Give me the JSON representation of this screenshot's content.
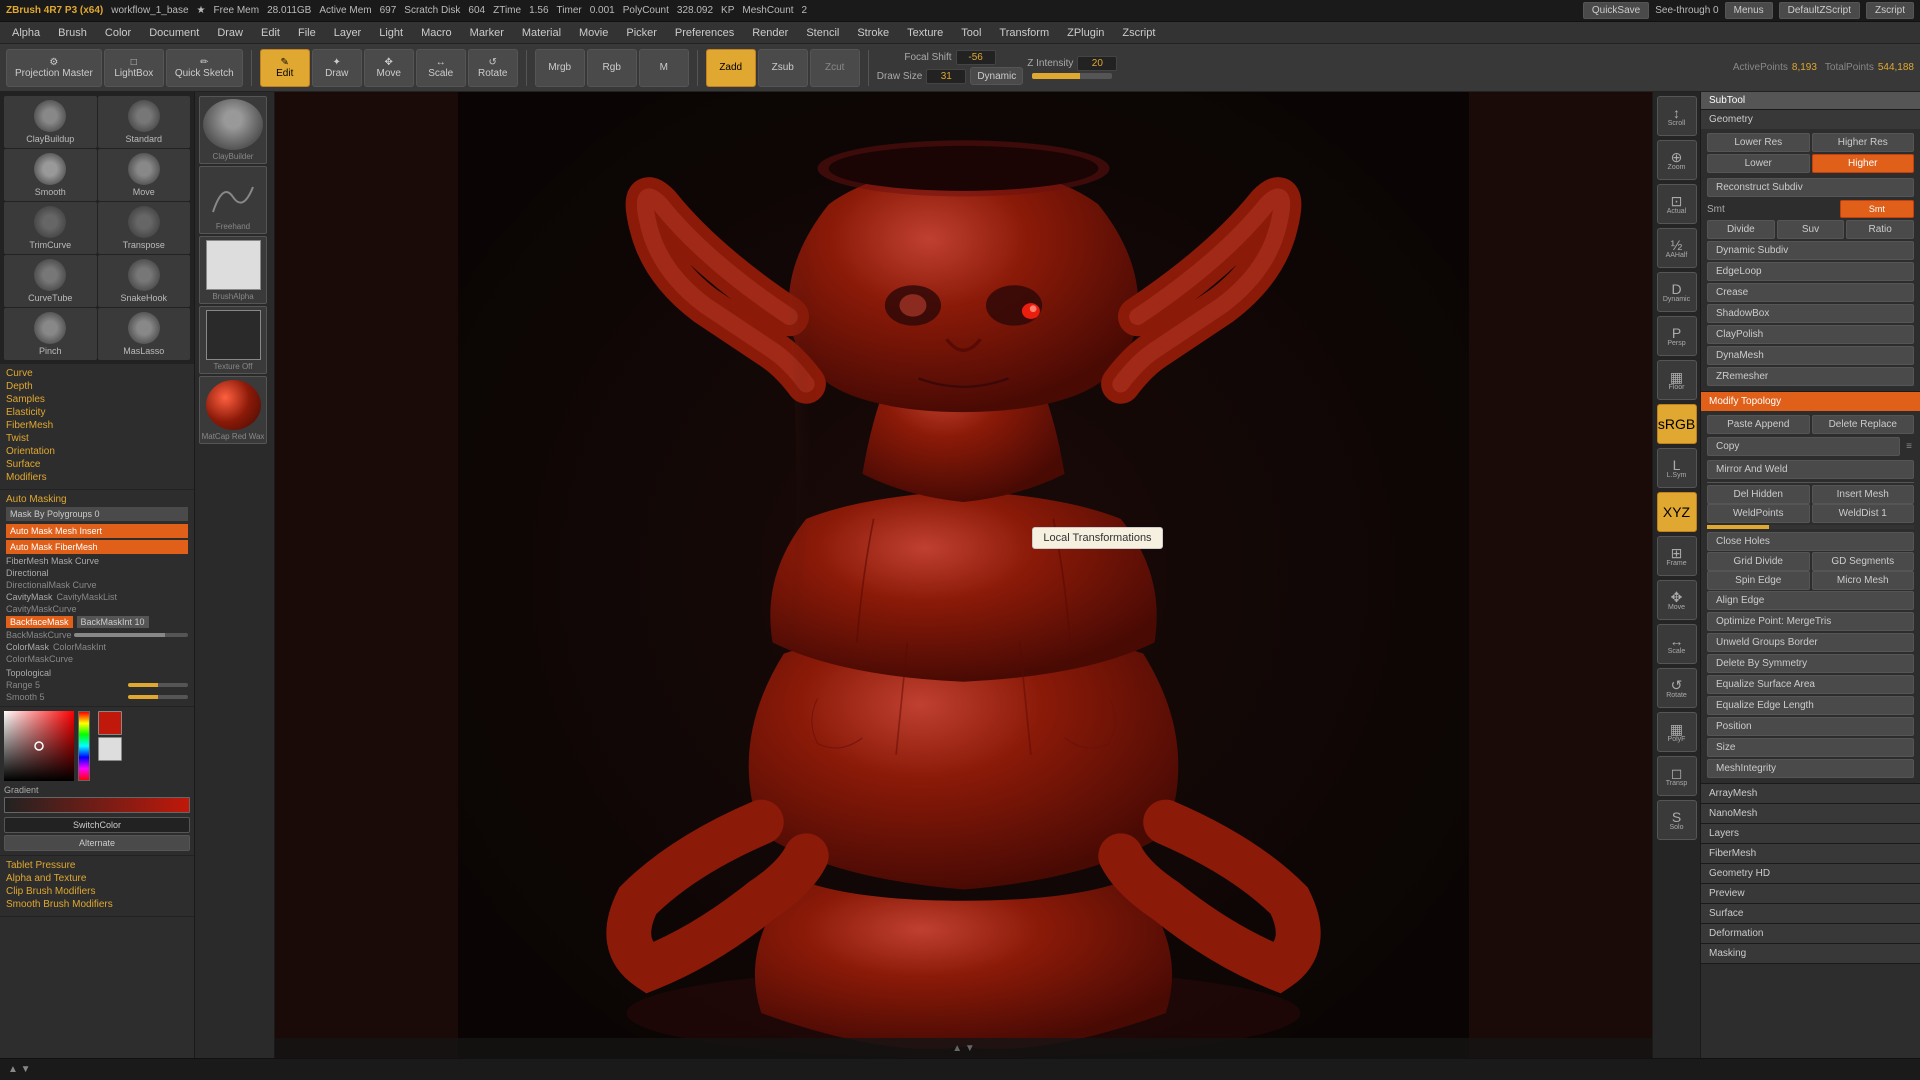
{
  "app": {
    "title": "ZBrush 4R7 P3 (x64)",
    "workflow": "workflow_1_base",
    "free_mem": "28.011GB",
    "active_mem": "697",
    "scratch_disk": "604",
    "ztime": "1.56",
    "timer": "0.001",
    "poly_count": "328.092",
    "kp": "KP",
    "mesh_count": "2"
  },
  "top_bar": {
    "items": [
      "ZBrush 4R7 P3 (x64)",
      "workflow_1_base",
      "Free Mem 28.011GB",
      "Active Mem 697",
      "Scratch Disk 604",
      "ZTime 1.56",
      "Timer 0.001",
      "PolyCount 328.092 KP",
      "MeshCount 2"
    ],
    "quick_save": "QuickSave",
    "see_through": "See-through 0",
    "menus": "Menus",
    "default_z_script": "DefaultZScript",
    "zscript": "Zscript"
  },
  "menu_bar": {
    "items": [
      "Alpha",
      "Brush",
      "Color",
      "Document",
      "Draw",
      "Edit",
      "File",
      "Layer",
      "Light",
      "Macro",
      "Marker",
      "Material",
      "Movie",
      "Picker",
      "Preferences",
      "Render",
      "Stencil",
      "Stroke",
      "Texture",
      "Tool",
      "Transform",
      "ZPlugin",
      "Zscript"
    ]
  },
  "toolbar": {
    "projection_master": "Projection Master",
    "lightbox": "LightBox",
    "quick_sketch": "Quick Sketch",
    "edit": "Edit",
    "draw": "Draw",
    "move": "Move",
    "scale": "Scale",
    "rotate": "Rotate",
    "mrgb": "Mrgb",
    "rgb": "Rgb",
    "m": "M",
    "zadd": "Zadd",
    "zsub": "Zsub",
    "zcut": "Zcut",
    "focal_shift_label": "Focal Shift",
    "focal_shift_value": "-56",
    "draw_size_label": "Draw Size",
    "draw_size_value": "31",
    "dynamic": "Dynamic",
    "z_intensity_label": "Z Intensity",
    "z_intensity_value": "20",
    "active_points_label": "ActivePoints",
    "active_points_value": "8,193",
    "total_points_label": "TotalPoints",
    "total_points_value": "544,188"
  },
  "left_panel": {
    "brushes": [
      {
        "name": "ClayBuildup",
        "type": "round"
      },
      {
        "name": "Standard",
        "type": "round"
      },
      {
        "name": "Smooth",
        "type": "smooth"
      },
      {
        "name": "Move",
        "type": "move"
      },
      {
        "name": "TrimCurve",
        "type": "trim"
      },
      {
        "name": "Transpose",
        "type": "transpose"
      },
      {
        "name": "CurveTube",
        "type": "curve"
      },
      {
        "name": "SnakeHook",
        "type": "snake"
      },
      {
        "name": "Pinch",
        "type": "pinch"
      },
      {
        "name": "MasLasso",
        "type": "lasso"
      }
    ],
    "properties": {
      "curve": "Curve",
      "depth": "Depth",
      "samples": "Samples",
      "elasticity": "Elasticity",
      "fibermesh": "FiberMesh",
      "twist": "Twist",
      "orientation": "Orientation",
      "surface": "Surface",
      "modifiers": "Modifiers"
    },
    "auto_masking": {
      "label": "Auto Masking",
      "mask_by_polygroups": "Mask By Polygroups 0",
      "auto_mask_mesh_insert": "Auto Mask Mesh Insert",
      "auto_mask_fibermesh": "Auto Mask FiberMesh",
      "fibermesh_mask_curve": "FiberMesh Mask Curve",
      "directional": "Directional",
      "directional_mask_curve": "DirectionalMask Curve",
      "cavitymask": "CavityMask",
      "cavitymask_list": "CavityMaskList",
      "cavitymask_curve": "CavityMaskCurve",
      "backface_mask": "BackfaceMask",
      "backmask_int": "BackMaskInt 10",
      "backmask_curve": "BackMaskCurve",
      "color_mask": "ColorMask",
      "color_mask_int": "ColorMaskInt",
      "color_mask_curve": "ColorMaskCurve",
      "topological": "Topological",
      "range": "Range 5",
      "smooth": "Smooth 5"
    },
    "bottom_items": [
      "Tablet Pressure",
      "Alpha and Texture",
      "Clip Brush Modifiers",
      "Smooth Brush Modifiers"
    ]
  },
  "brush_thumbnails": [
    {
      "label": "ClayBuilder",
      "shape": "sphere"
    },
    {
      "label": "Freehand",
      "shape": "stroke"
    },
    {
      "label": "BrushAlpha",
      "shape": "white_square"
    },
    {
      "label": "Texture Off",
      "shape": "texture"
    },
    {
      "label": "MatCap Red Wax",
      "shape": "red_sphere"
    }
  ],
  "viewport": {
    "tooltip": "Local Transformations"
  },
  "right_tools": [
    {
      "name": "scroll",
      "label": "Scroll",
      "icon": "↕"
    },
    {
      "name": "zoom",
      "label": "Zoom",
      "icon": "🔍"
    },
    {
      "name": "actual",
      "label": "Actual",
      "icon": "⊡"
    },
    {
      "name": "aaHalf",
      "label": "AAHalf",
      "icon": "½"
    },
    {
      "name": "dynamic",
      "label": "Dynamic",
      "icon": "D"
    },
    {
      "name": "persp",
      "label": "Persp",
      "icon": "P"
    },
    {
      "name": "floor",
      "label": "Floor",
      "icon": "▦"
    },
    {
      "name": "srgb",
      "label": "sRGB",
      "icon": "RGB",
      "active": true
    },
    {
      "name": "layer",
      "label": "L.Sym",
      "icon": "L"
    },
    {
      "name": "xyz",
      "label": "XYZ",
      "icon": "X",
      "active": true
    },
    {
      "name": "frame",
      "label": "Frame",
      "icon": "⊞"
    },
    {
      "name": "move",
      "label": "Move",
      "icon": "✥"
    },
    {
      "name": "scale",
      "label": "Scale",
      "icon": "↔"
    },
    {
      "name": "rotate",
      "label": "Rotate",
      "icon": "↺"
    },
    {
      "name": "polyf",
      "label": "PolyF",
      "icon": "▦"
    },
    {
      "name": "transp",
      "label": "Transp",
      "icon": "◻"
    },
    {
      "name": "solo",
      "label": "Solo",
      "icon": "S"
    }
  ],
  "right_panel": {
    "subtool_label": "SubTool",
    "geometry_label": "Geometry",
    "higher_res": "Higher Res",
    "lower_res": "Lower Res",
    "higher": "Higher",
    "lower": "Lower",
    "reconstruct_subdiv": "Reconstruct Subdiv",
    "smt_label": "Smt",
    "divide_label": "Divide",
    "suv_label": "Suv",
    "ratiie_label": "Ratio",
    "dynamic_subdiv": "Dynamic Subdiv",
    "edge_loop": "EdgeLoop",
    "crease": "Crease",
    "shadow_box": "ShadowBox",
    "clay_polish": "ClayPolish",
    "dyna_mesh": "DynaMesh",
    "z_remesher": "ZRemesher",
    "modify_topology": "Modify Topology",
    "paste_appand": "Paste Append",
    "delete_replace": "Delete Replace",
    "copy": "Copy",
    "mirror_and_weld": "Mirror And Weld",
    "del_hidden": "Del Hidden",
    "insert_mesh": "Insert Mesh",
    "weld_points": "WeldPoints",
    "weld_dist_1": "WeldDist 1",
    "close_holes": "Close Holes",
    "grid_divide": "Grid Divide",
    "gd_segments": "GD Segments",
    "spin_edge": "Spin Edge",
    "micro_mesh": "Micro Mesh",
    "align_edge": "Align Edge",
    "optimize_point_mergetris": "Optimize Point: MergeTris",
    "unweld_groups_border": "Unweld Groups Border",
    "delete_by_symmetry": "Delete By Symmetry",
    "equalize_surface_area": "Equalize Surface Area",
    "equalize_edge_length": "Equalize Edge Length",
    "position": "Position",
    "size": "Size",
    "mesh_integrity": "MeshIntegrity",
    "array_mesh": "ArrayMesh",
    "nano_mesh": "NanoMesh",
    "layers": "Layers",
    "fibermesh": "FiberMesh",
    "geometry_hd": "Geometry HD",
    "preview": "Preview",
    "surface": "Surface",
    "deformation": "Deformation",
    "masking": "Masking"
  },
  "bottom_bar": {
    "nav_label": "▲ ▼"
  },
  "color_picker": {
    "gradient_label": "Gradient",
    "switch_color": "SwitchColor",
    "alternate": "Alternate"
  }
}
